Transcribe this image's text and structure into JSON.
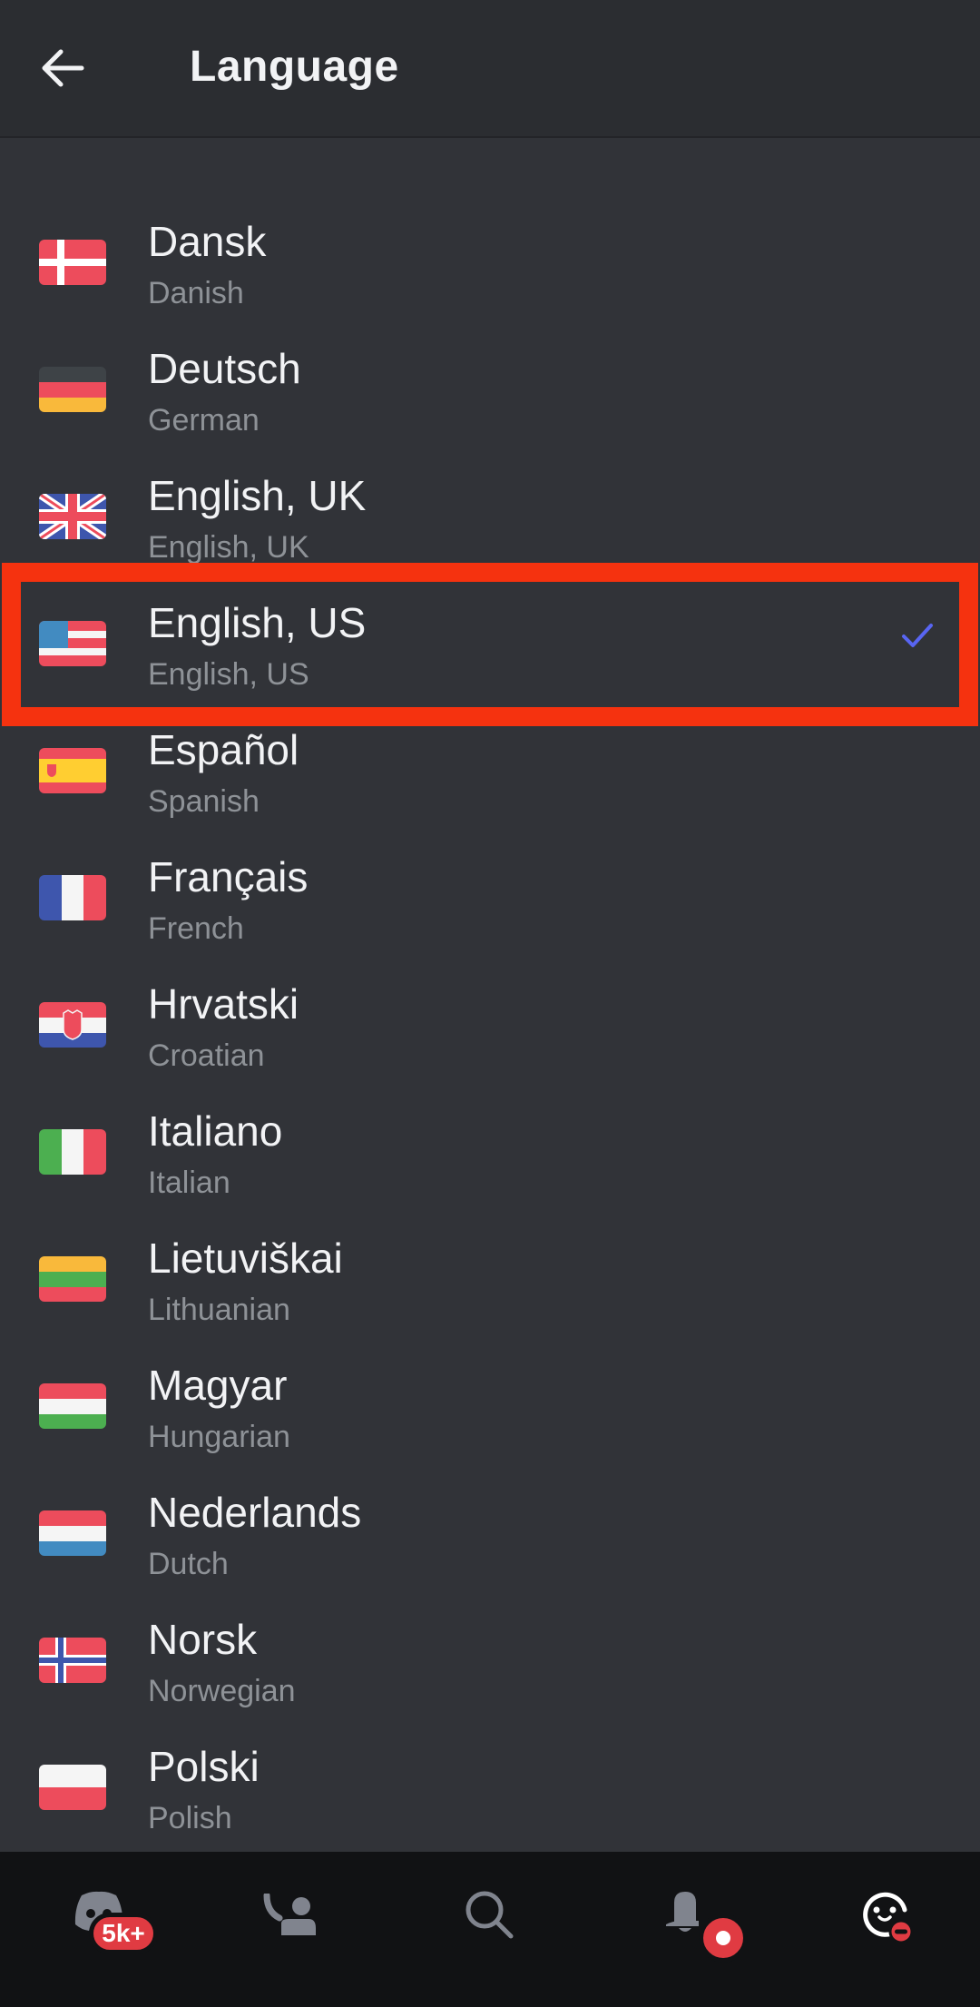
{
  "header": {
    "title": "Language",
    "back_icon": "arrow-left-icon"
  },
  "colors": {
    "background": "#313338",
    "header_background": "#2b2d31",
    "nav_background": "#111214",
    "title_text": "#f2f3f5",
    "subtitle_text": "#8e9297",
    "accent": "#5865f2",
    "highlight_border": "#f5320f",
    "badge_red": "#e03b42"
  },
  "languages": [
    {
      "name": "Dansk",
      "english": "Danish",
      "flag": "flag-denmark-icon",
      "selected": false
    },
    {
      "name": "Deutsch",
      "english": "German",
      "flag": "flag-germany-icon",
      "selected": false
    },
    {
      "name": "English, UK",
      "english": "English, UK",
      "flag": "flag-uk-icon",
      "selected": false
    },
    {
      "name": "English, US",
      "english": "English, US",
      "flag": "flag-us-icon",
      "selected": true
    },
    {
      "name": "Español",
      "english": "Spanish",
      "flag": "flag-spain-icon",
      "selected": false
    },
    {
      "name": "Français",
      "english": "French",
      "flag": "flag-france-icon",
      "selected": false
    },
    {
      "name": "Hrvatski",
      "english": "Croatian",
      "flag": "flag-croatia-icon",
      "selected": false
    },
    {
      "name": "Italiano",
      "english": "Italian",
      "flag": "flag-italy-icon",
      "selected": false
    },
    {
      "name": "Lietuviškai",
      "english": "Lithuanian",
      "flag": "flag-lithuania-icon",
      "selected": false
    },
    {
      "name": "Magyar",
      "english": "Hungarian",
      "flag": "flag-hungary-icon",
      "selected": false
    },
    {
      "name": "Nederlands",
      "english": "Dutch",
      "flag": "flag-netherlands-icon",
      "selected": false
    },
    {
      "name": "Norsk",
      "english": "Norwegian",
      "flag": "flag-norway-icon",
      "selected": false
    },
    {
      "name": "Polski",
      "english": "Polish",
      "flag": "flag-poland-icon",
      "selected": false
    }
  ],
  "nav": {
    "items": [
      {
        "name": "home",
        "icon": "discord-logo-icon",
        "badge": "5k+"
      },
      {
        "name": "friends",
        "icon": "friends-icon"
      },
      {
        "name": "search",
        "icon": "search-icon"
      },
      {
        "name": "notifications",
        "icon": "bell-icon",
        "badge": "dot"
      },
      {
        "name": "profile",
        "icon": "avatar-icon",
        "status": "do-not-disturb"
      }
    ]
  }
}
